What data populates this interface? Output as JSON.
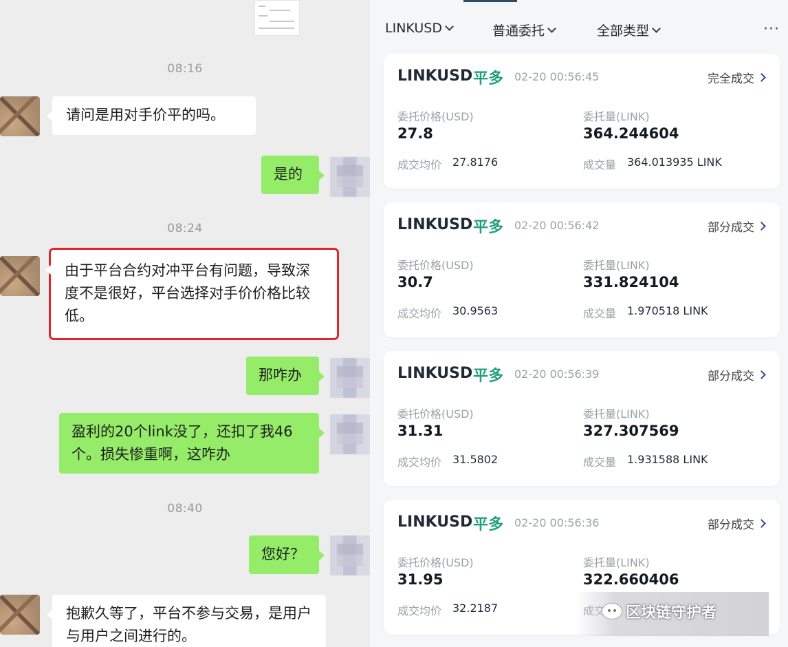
{
  "chat": {
    "messages": [
      {
        "kind": "time",
        "text": "08:16"
      },
      {
        "kind": "in",
        "text": "请问是用对手价平的吗。"
      },
      {
        "kind": "out",
        "text": "是的"
      },
      {
        "kind": "time",
        "text": "08:24"
      },
      {
        "kind": "in",
        "text": "由于平台合约对冲平台有问题，导致深度不是很好，平台选择对手价价格比较低。",
        "highlighted": true
      },
      {
        "kind": "out",
        "text": "那咋办"
      },
      {
        "kind": "out",
        "text": "盈利的20个link没了，还扣了我46个。损失惨重啊，这咋办"
      },
      {
        "kind": "time",
        "text": "08:40"
      },
      {
        "kind": "out",
        "text": "您好？"
      },
      {
        "kind": "in",
        "text": "抱歉久等了，平台不参与交易，是用户与用户之间进行的。"
      }
    ]
  },
  "orders": {
    "filters": {
      "symbol": "LINKUSD",
      "order_type": "普通委托",
      "all_types": "全部类型",
      "more": "···"
    },
    "labels": {
      "price": "委托价格(USD)",
      "amount": "委托量(LINK)",
      "avg_price": "成交均价",
      "filled": "成交量"
    },
    "cards": [
      {
        "symbol": "LINKUSD",
        "side": "平多",
        "time": "02-20 00:56:45",
        "status": "完全成交",
        "price": "27.8",
        "amount": "364.244604",
        "avg_price": "27.8176",
        "filled": "364.013935 LINK"
      },
      {
        "symbol": "LINKUSD",
        "side": "平多",
        "time": "02-20 00:56:42",
        "status": "部分成交",
        "price": "30.7",
        "amount": "331.824104",
        "avg_price": "30.9563",
        "filled": "1.970518 LINK"
      },
      {
        "symbol": "LINKUSD",
        "side": "平多",
        "time": "02-20 00:56:39",
        "status": "部分成交",
        "price": "31.31",
        "amount": "327.307569",
        "avg_price": "31.5802",
        "filled": "1.931588 LINK"
      },
      {
        "symbol": "LINKUSD",
        "side": "平多",
        "time": "02-20 00:56:36",
        "status": "部分成交",
        "price": "31.95",
        "amount": "322.660406",
        "avg_price": "32.2187",
        "filled": ""
      }
    ]
  },
  "watermark": {
    "text": "区块链守护者"
  },
  "colors": {
    "chat_bg": "#ededed",
    "bubble_out": "#95ec69",
    "bubble_in": "#ffffff",
    "side_green": "#22a07e",
    "highlight_red": "#e0262b"
  }
}
